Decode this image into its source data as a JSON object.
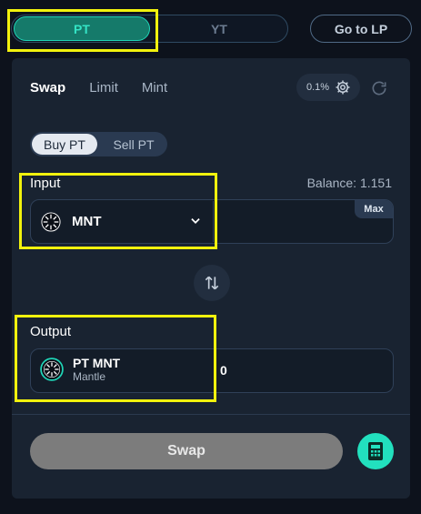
{
  "top_tabs": {
    "pt": "PT",
    "yt": "YT",
    "goto_lp": "Go to LP"
  },
  "mode_tabs": [
    "Swap",
    "Limit",
    "Mint"
  ],
  "slippage": "0.1%",
  "buy_sell": {
    "buy": "Buy PT",
    "sell": "Sell PT"
  },
  "input": {
    "label": "Input",
    "balance": "Balance: 1.151",
    "token": "MNT",
    "max_label": "Max"
  },
  "output": {
    "label": "Output",
    "token": "PT MNT",
    "chain": "Mantle",
    "value": "0"
  },
  "swap_label": "Swap",
  "colors": {
    "accent": "#1fd5b7",
    "highlight": "#f2f20d",
    "panel": "#192331",
    "background": "#0d121c"
  },
  "icons": {
    "settings": "gear-icon",
    "refresh": "refresh-icon",
    "token": "mantle-token-icon",
    "dropdown": "chevron-down-icon",
    "swap_direction": "swap-arrows-icon",
    "calculator": "calculator-icon"
  }
}
